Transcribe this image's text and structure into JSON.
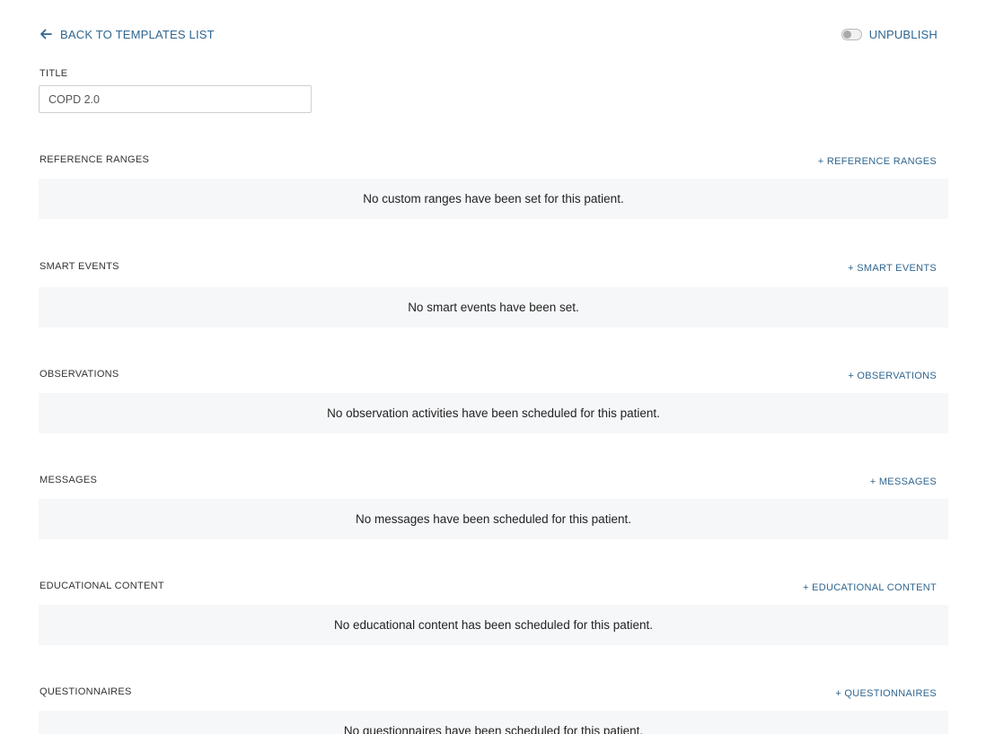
{
  "header": {
    "back_label": "BACK TO TEMPLATES LIST",
    "unpublish_label": "UNPUBLISH"
  },
  "title_field": {
    "label": "TITLE",
    "value": "COPD 2.0"
  },
  "sections": [
    {
      "title": "REFERENCE RANGES",
      "add_label": "+ REFERENCE RANGES",
      "empty_text": "No custom ranges have been set for this patient."
    },
    {
      "title": "SMART EVENTS",
      "add_label": "+ SMART EVENTS",
      "empty_text": "No smart events have been set."
    },
    {
      "title": "OBSERVATIONS",
      "add_label": "+ OBSERVATIONS",
      "empty_text": "No observation activities have been scheduled for this patient."
    },
    {
      "title": "MESSAGES",
      "add_label": "+ MESSAGES",
      "empty_text": "No messages have been scheduled for this patient."
    },
    {
      "title": "EDUCATIONAL CONTENT",
      "add_label": "+ EDUCATIONAL CONTENT",
      "empty_text": "No educational content has been scheduled for this patient."
    },
    {
      "title": "QUESTIONNAIRES",
      "add_label": "+ QUESTIONNAIRES",
      "empty_text": "No questionnaires have been scheduled for this patient."
    }
  ],
  "colors": {
    "link": "#2f6690",
    "panel_bg": "#f6f7f9"
  },
  "icons": {
    "back": "arrow-left-icon",
    "toggle": "toggle-off-icon"
  }
}
